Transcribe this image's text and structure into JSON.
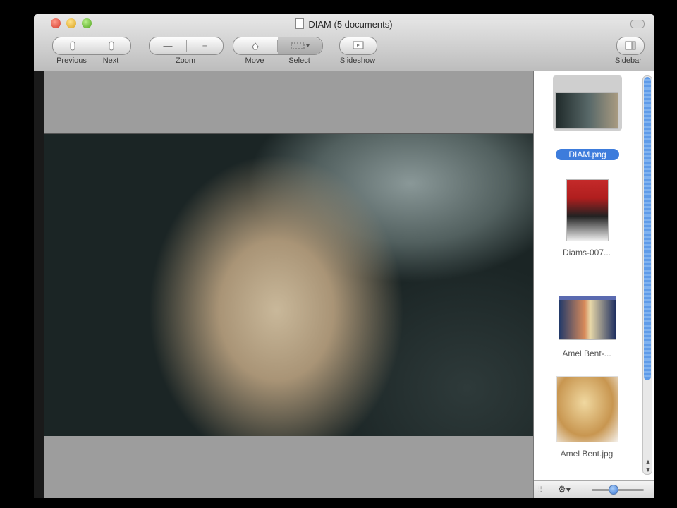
{
  "window": {
    "title": "DIAM (5 documents)"
  },
  "toolbar": {
    "previous_label": "Previous",
    "next_label": "Next",
    "zoom_label": "Zoom",
    "move_label": "Move",
    "select_label": "Select",
    "slideshow_label": "Slideshow",
    "sidebar_label": "Sidebar",
    "zoom_out_glyph": "—",
    "zoom_in_glyph": "+"
  },
  "sidebar": {
    "items": [
      {
        "label": "DIAM.png",
        "selected": true
      },
      {
        "label": "Diams-007...",
        "selected": false
      },
      {
        "label": "Amel Bent-...",
        "selected": false
      },
      {
        "label": "Amel Bent.jpg",
        "selected": false
      }
    ]
  },
  "icons": {
    "traffic_close": "close-icon",
    "gear": "gear-icon"
  }
}
